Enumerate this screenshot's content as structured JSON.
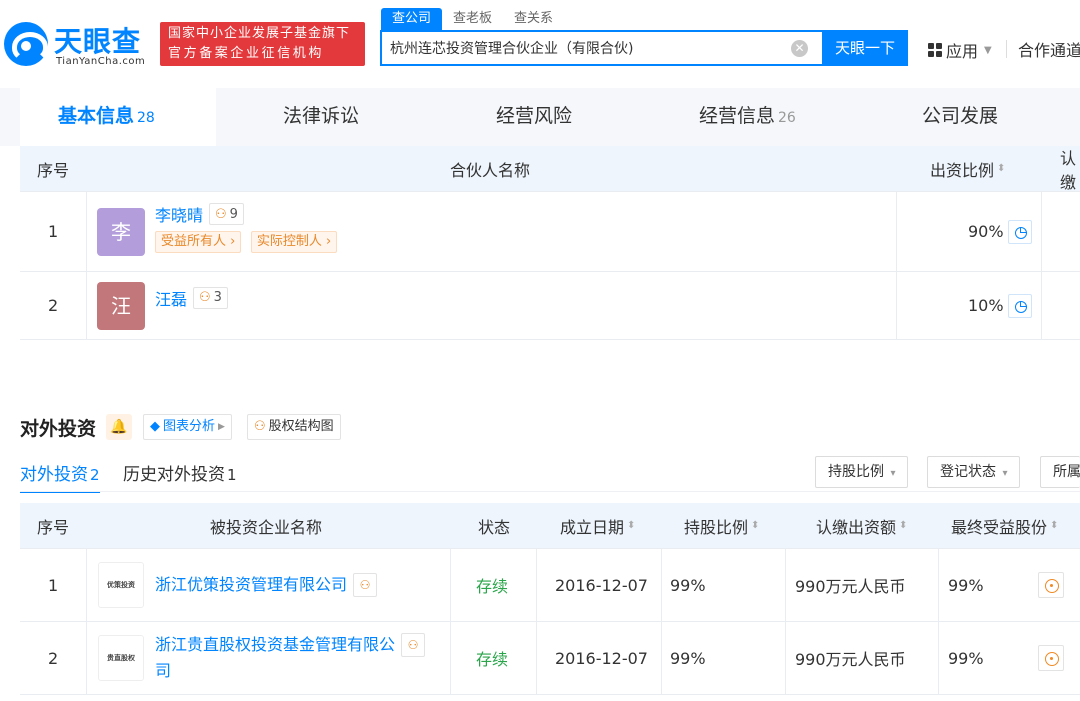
{
  "header": {
    "logo_cn": "天眼查",
    "logo_en": "TianYanCha.com",
    "banner_line1": "国家中小企业发展子基金旗下",
    "banner_line2": "官方备案企业征信机构",
    "search_tabs": [
      "查公司",
      "查老板",
      "查关系"
    ],
    "search_value": "杭州连芯投资管理合伙企业（有限合伙)",
    "search_button": "天眼一下",
    "apps_label": "应用",
    "coop_label": "合作通道"
  },
  "nav": {
    "tabs": [
      {
        "label": "基本信息",
        "count": "28"
      },
      {
        "label": "法律诉讼",
        "count": ""
      },
      {
        "label": "经营风险",
        "count": ""
      },
      {
        "label": "经营信息",
        "count": "26"
      },
      {
        "label": "公司发展",
        "count": ""
      }
    ]
  },
  "partners": {
    "headers": {
      "index": "序号",
      "name": "合伙人名称",
      "ratio": "出资比例",
      "extra": "认缴"
    },
    "rows": [
      {
        "index": "1",
        "avatar": "李",
        "avatar_color": "#b39ddb",
        "name": "李晓晴",
        "relations": "9",
        "tags": [
          "受益所有人",
          "实际控制人"
        ],
        "ratio": "90%"
      },
      {
        "index": "2",
        "avatar": "汪",
        "avatar_color": "#c2777a",
        "name": "汪磊",
        "relations": "3",
        "tags": [],
        "ratio": "10%"
      }
    ]
  },
  "investment": {
    "title": "对外投资",
    "chart_button": "图表分析",
    "structure_button": "股权结构图",
    "subtabs": [
      {
        "label": "对外投资",
        "count": "2"
      },
      {
        "label": "历史对外投资",
        "count": "1"
      }
    ],
    "filters": [
      "持股比例",
      "登记状态",
      "所属"
    ],
    "headers": {
      "index": "序号",
      "company": "被投资企业名称",
      "status": "状态",
      "date": "成立日期",
      "share": "持股比例",
      "capital": "认缴出资额",
      "final": "最终受益股份"
    },
    "rows": [
      {
        "index": "1",
        "logo_text": "优策投资",
        "company": "浙江优策投资管理有限公司",
        "status": "存续",
        "date": "2016-12-07",
        "share": "99%",
        "capital": "990万元人民币",
        "final": "99%"
      },
      {
        "index": "2",
        "logo_text": "贵直股权",
        "company_line1": "浙江贵直股权投资基金管理有限公",
        "company_line2": "司",
        "status": "存续",
        "date": "2016-12-07",
        "share": "99%",
        "capital": "990万元人民币",
        "final": "99%"
      }
    ]
  },
  "colors": {
    "accent": "#0084ff",
    "banner": "#e4393c",
    "status_ok": "#2aa54a",
    "tag": "#e8892b"
  }
}
